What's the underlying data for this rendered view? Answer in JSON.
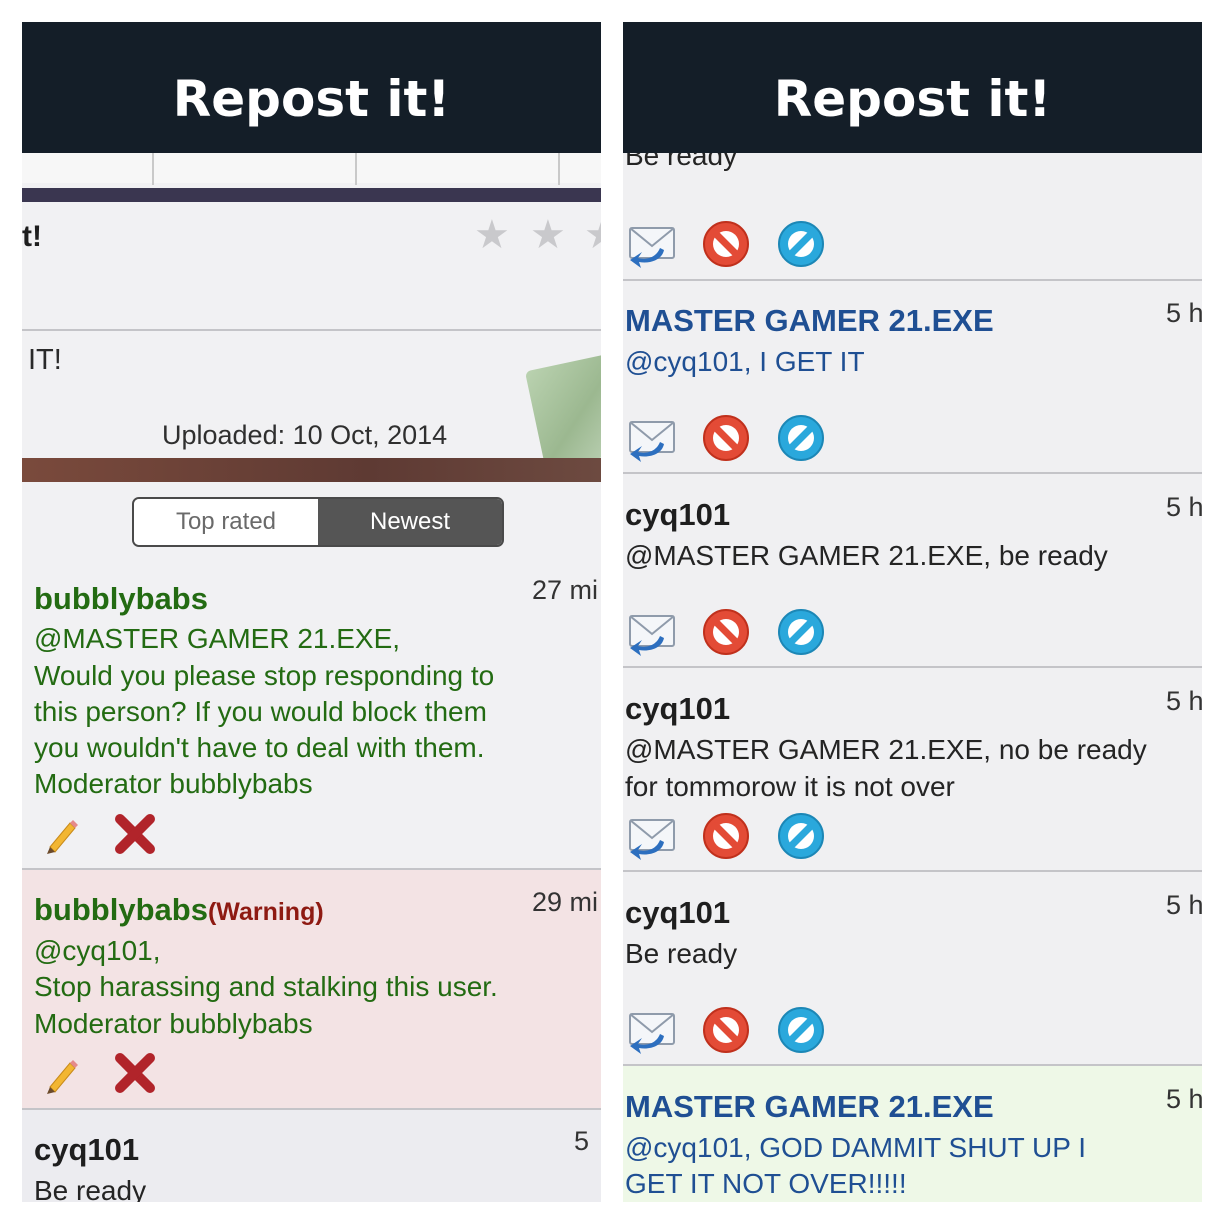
{
  "banner": {
    "title": "Repost it!"
  },
  "left": {
    "title_fragment": "t!",
    "description_fragment": "IT!",
    "uploaded": "Uploaded: 10 Oct, 2014",
    "sort_tabs": {
      "top_rated": "Top rated",
      "newest": "Newest",
      "active": "Newest"
    },
    "comments": [
      {
        "user": "bubblybabs",
        "time": "27 mi",
        "lines": [
          "@MASTER GAMER 21.EXE,",
          "Would you please stop responding to",
          "this person? If you would block them",
          "you wouldn't have to deal with them.",
          "Moderator bubblybabs"
        ],
        "actions": [
          "pencil-icon",
          "delete-x-icon"
        ]
      },
      {
        "user": "bubblybabs",
        "badge": "(Warning)",
        "time": "29 mi",
        "lines": [
          "@cyq101,",
          "Stop harassing and stalking this user.",
          "Moderator bubblybabs"
        ],
        "actions": [
          "pencil-icon",
          "delete-x-icon"
        ]
      },
      {
        "user": "cyq101",
        "time": "5",
        "lines": [
          "Be ready"
        ]
      }
    ]
  },
  "right": {
    "top_fragment": "Be ready",
    "comments": [
      {
        "user": "MASTER GAMER 21.EXE",
        "time": "5 h",
        "lines": [
          "@cyq101, I GET IT"
        ]
      },
      {
        "user": "cyq101",
        "time": "5 h",
        "lines": [
          "@MASTER GAMER 21.EXE, be ready"
        ]
      },
      {
        "user": "cyq101",
        "time": "5 h",
        "lines": [
          "@MASTER GAMER 21.EXE, no be ready",
          "for tommorow it is not over"
        ]
      },
      {
        "user": "cyq101",
        "time": "5 h",
        "lines": [
          "Be ready"
        ]
      },
      {
        "user": "MASTER GAMER 21.EXE",
        "time": "5 h",
        "lines": [
          "@cyq101, GOD DAMMIT SHUT UP I",
          "GET IT NOT OVER!!!!!"
        ]
      }
    ],
    "action_icons": [
      "reply-envelope-icon",
      "block-icon",
      "ban-icon"
    ]
  },
  "colors": {
    "banner_bg": "#141e28",
    "moderator_green": "#236b12",
    "master_blue": "#1f4f93",
    "warning_red": "#8e1a12",
    "warning_row_bg": "#f3e3e4",
    "highlight_row_bg": "#eef8e7"
  }
}
